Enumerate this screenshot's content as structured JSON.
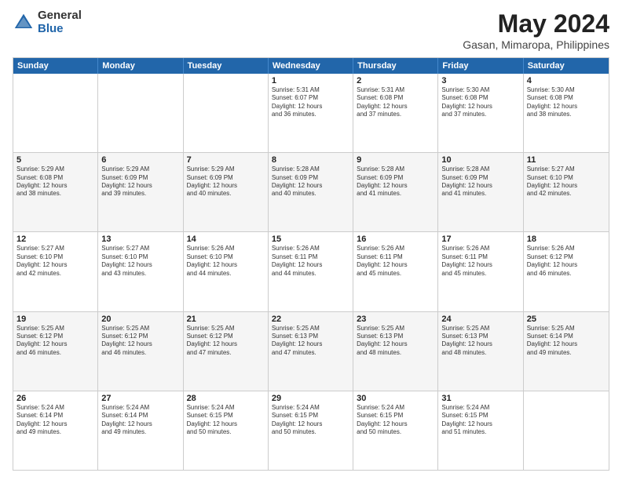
{
  "logo": {
    "general": "General",
    "blue": "Blue"
  },
  "title": "May 2024",
  "subtitle": "Gasan, Mimaropa, Philippines",
  "header_days": [
    "Sunday",
    "Monday",
    "Tuesday",
    "Wednesday",
    "Thursday",
    "Friday",
    "Saturday"
  ],
  "rows": [
    [
      {
        "day": "",
        "lines": []
      },
      {
        "day": "",
        "lines": []
      },
      {
        "day": "",
        "lines": []
      },
      {
        "day": "1",
        "lines": [
          "Sunrise: 5:31 AM",
          "Sunset: 6:07 PM",
          "Daylight: 12 hours",
          "and 36 minutes."
        ]
      },
      {
        "day": "2",
        "lines": [
          "Sunrise: 5:31 AM",
          "Sunset: 6:08 PM",
          "Daylight: 12 hours",
          "and 37 minutes."
        ]
      },
      {
        "day": "3",
        "lines": [
          "Sunrise: 5:30 AM",
          "Sunset: 6:08 PM",
          "Daylight: 12 hours",
          "and 37 minutes."
        ]
      },
      {
        "day": "4",
        "lines": [
          "Sunrise: 5:30 AM",
          "Sunset: 6:08 PM",
          "Daylight: 12 hours",
          "and 38 minutes."
        ]
      }
    ],
    [
      {
        "day": "5",
        "lines": [
          "Sunrise: 5:29 AM",
          "Sunset: 6:08 PM",
          "Daylight: 12 hours",
          "and 38 minutes."
        ]
      },
      {
        "day": "6",
        "lines": [
          "Sunrise: 5:29 AM",
          "Sunset: 6:09 PM",
          "Daylight: 12 hours",
          "and 39 minutes."
        ]
      },
      {
        "day": "7",
        "lines": [
          "Sunrise: 5:29 AM",
          "Sunset: 6:09 PM",
          "Daylight: 12 hours",
          "and 40 minutes."
        ]
      },
      {
        "day": "8",
        "lines": [
          "Sunrise: 5:28 AM",
          "Sunset: 6:09 PM",
          "Daylight: 12 hours",
          "and 40 minutes."
        ]
      },
      {
        "day": "9",
        "lines": [
          "Sunrise: 5:28 AM",
          "Sunset: 6:09 PM",
          "Daylight: 12 hours",
          "and 41 minutes."
        ]
      },
      {
        "day": "10",
        "lines": [
          "Sunrise: 5:28 AM",
          "Sunset: 6:09 PM",
          "Daylight: 12 hours",
          "and 41 minutes."
        ]
      },
      {
        "day": "11",
        "lines": [
          "Sunrise: 5:27 AM",
          "Sunset: 6:10 PM",
          "Daylight: 12 hours",
          "and 42 minutes."
        ]
      }
    ],
    [
      {
        "day": "12",
        "lines": [
          "Sunrise: 5:27 AM",
          "Sunset: 6:10 PM",
          "Daylight: 12 hours",
          "and 42 minutes."
        ]
      },
      {
        "day": "13",
        "lines": [
          "Sunrise: 5:27 AM",
          "Sunset: 6:10 PM",
          "Daylight: 12 hours",
          "and 43 minutes."
        ]
      },
      {
        "day": "14",
        "lines": [
          "Sunrise: 5:26 AM",
          "Sunset: 6:10 PM",
          "Daylight: 12 hours",
          "and 44 minutes."
        ]
      },
      {
        "day": "15",
        "lines": [
          "Sunrise: 5:26 AM",
          "Sunset: 6:11 PM",
          "Daylight: 12 hours",
          "and 44 minutes."
        ]
      },
      {
        "day": "16",
        "lines": [
          "Sunrise: 5:26 AM",
          "Sunset: 6:11 PM",
          "Daylight: 12 hours",
          "and 45 minutes."
        ]
      },
      {
        "day": "17",
        "lines": [
          "Sunrise: 5:26 AM",
          "Sunset: 6:11 PM",
          "Daylight: 12 hours",
          "and 45 minutes."
        ]
      },
      {
        "day": "18",
        "lines": [
          "Sunrise: 5:26 AM",
          "Sunset: 6:12 PM",
          "Daylight: 12 hours",
          "and 46 minutes."
        ]
      }
    ],
    [
      {
        "day": "19",
        "lines": [
          "Sunrise: 5:25 AM",
          "Sunset: 6:12 PM",
          "Daylight: 12 hours",
          "and 46 minutes."
        ]
      },
      {
        "day": "20",
        "lines": [
          "Sunrise: 5:25 AM",
          "Sunset: 6:12 PM",
          "Daylight: 12 hours",
          "and 46 minutes."
        ]
      },
      {
        "day": "21",
        "lines": [
          "Sunrise: 5:25 AM",
          "Sunset: 6:12 PM",
          "Daylight: 12 hours",
          "and 47 minutes."
        ]
      },
      {
        "day": "22",
        "lines": [
          "Sunrise: 5:25 AM",
          "Sunset: 6:13 PM",
          "Daylight: 12 hours",
          "and 47 minutes."
        ]
      },
      {
        "day": "23",
        "lines": [
          "Sunrise: 5:25 AM",
          "Sunset: 6:13 PM",
          "Daylight: 12 hours",
          "and 48 minutes."
        ]
      },
      {
        "day": "24",
        "lines": [
          "Sunrise: 5:25 AM",
          "Sunset: 6:13 PM",
          "Daylight: 12 hours",
          "and 48 minutes."
        ]
      },
      {
        "day": "25",
        "lines": [
          "Sunrise: 5:25 AM",
          "Sunset: 6:14 PM",
          "Daylight: 12 hours",
          "and 49 minutes."
        ]
      }
    ],
    [
      {
        "day": "26",
        "lines": [
          "Sunrise: 5:24 AM",
          "Sunset: 6:14 PM",
          "Daylight: 12 hours",
          "and 49 minutes."
        ]
      },
      {
        "day": "27",
        "lines": [
          "Sunrise: 5:24 AM",
          "Sunset: 6:14 PM",
          "Daylight: 12 hours",
          "and 49 minutes."
        ]
      },
      {
        "day": "28",
        "lines": [
          "Sunrise: 5:24 AM",
          "Sunset: 6:15 PM",
          "Daylight: 12 hours",
          "and 50 minutes."
        ]
      },
      {
        "day": "29",
        "lines": [
          "Sunrise: 5:24 AM",
          "Sunset: 6:15 PM",
          "Daylight: 12 hours",
          "and 50 minutes."
        ]
      },
      {
        "day": "30",
        "lines": [
          "Sunrise: 5:24 AM",
          "Sunset: 6:15 PM",
          "Daylight: 12 hours",
          "and 50 minutes."
        ]
      },
      {
        "day": "31",
        "lines": [
          "Sunrise: 5:24 AM",
          "Sunset: 6:15 PM",
          "Daylight: 12 hours",
          "and 51 minutes."
        ]
      },
      {
        "day": "",
        "lines": []
      }
    ]
  ]
}
